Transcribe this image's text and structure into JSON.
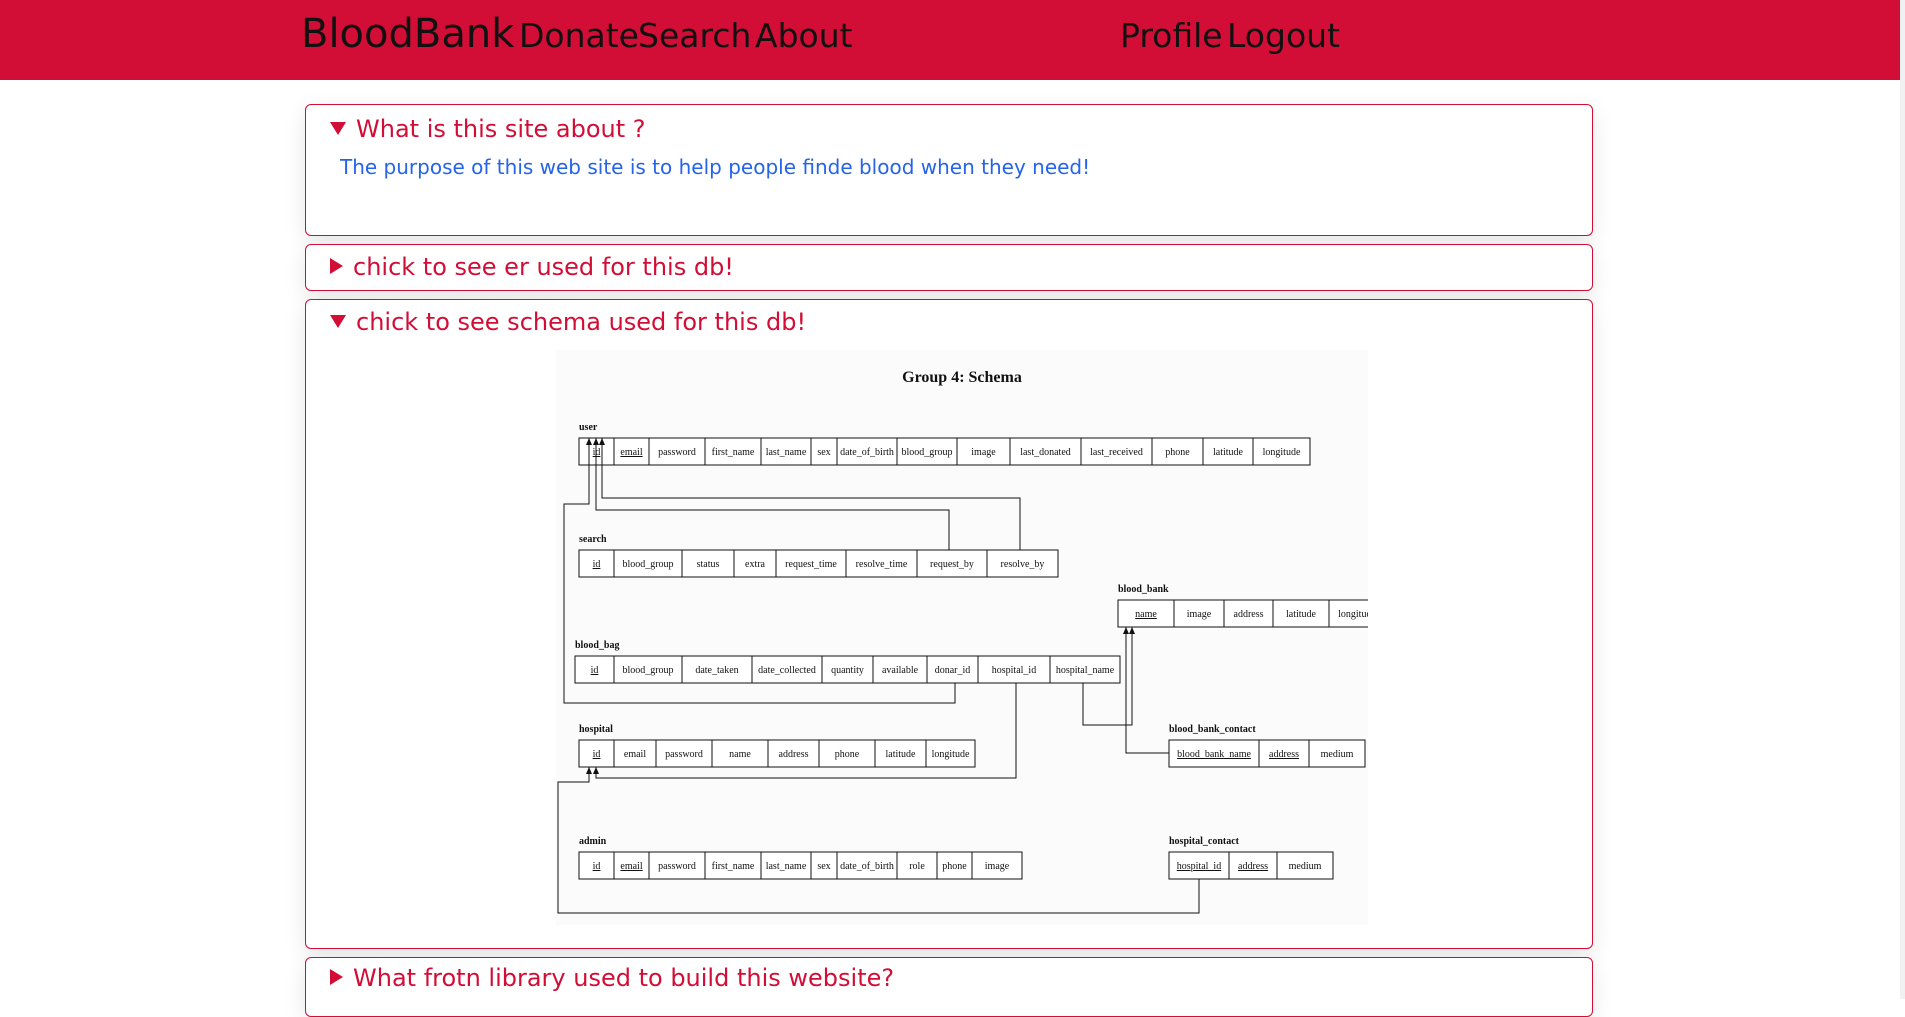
{
  "nav": {
    "brand": "BloodBank",
    "links": [
      "Donate",
      "Search",
      "About"
    ],
    "right_links": [
      "Profile",
      "Logout"
    ]
  },
  "faq": [
    {
      "question": "What is this site about ?",
      "answer": "The purpose of this web site is to help people finde blood when they need!",
      "open": true
    },
    {
      "question": "chick to see er used for this db!",
      "open": false
    },
    {
      "question": "chick to see schema used for this db!",
      "open": true
    },
    {
      "question": "What frotn library used to build this website?",
      "open": false
    }
  ],
  "schema": {
    "title": "Group 4: Schema",
    "tables": [
      {
        "name": "user",
        "columns": [
          "id",
          "email",
          "password",
          "first_name",
          "last_name",
          "sex",
          "date_of_birth",
          "blood_group",
          "image",
          "last_donated",
          "last_received",
          "phone",
          "latitude",
          "longitude"
        ],
        "keys": [
          "id",
          "email"
        ]
      },
      {
        "name": "search",
        "columns": [
          "id",
          "blood_group",
          "status",
          "extra",
          "request_time",
          "resolve_time",
          "request_by",
          "resolve_by"
        ],
        "keys": [
          "id"
        ]
      },
      {
        "name": "blood_bank",
        "columns": [
          "name",
          "image",
          "address",
          "latitude",
          "longitude"
        ],
        "keys": [
          "name"
        ]
      },
      {
        "name": "blood_bag",
        "columns": [
          "id",
          "blood_group",
          "date_taken",
          "date_collected",
          "quantity",
          "available",
          "donar_id",
          "hospital_id",
          "hospital_name"
        ],
        "keys": [
          "id"
        ]
      },
      {
        "name": "hospital",
        "columns": [
          "id",
          "email",
          "password",
          "name",
          "address",
          "phone",
          "latitude",
          "longitude"
        ],
        "keys": [
          "id"
        ]
      },
      {
        "name": "blood_bank_contact",
        "columns": [
          "blood_bank_name",
          "address",
          "medium"
        ],
        "keys": [
          "blood_bank_name",
          "address"
        ]
      },
      {
        "name": "admin",
        "columns": [
          "id",
          "email",
          "password",
          "first_name",
          "last_name",
          "sex",
          "date_of_birth",
          "role",
          "phone",
          "image"
        ],
        "keys": [
          "id",
          "email"
        ]
      },
      {
        "name": "hospital_contact",
        "columns": [
          "hospital_id",
          "address",
          "medium"
        ],
        "keys": [
          "hospital_id",
          "address"
        ]
      }
    ]
  },
  "colors": {
    "primary": "#d20d36",
    "answer_text": "#2563eb"
  }
}
